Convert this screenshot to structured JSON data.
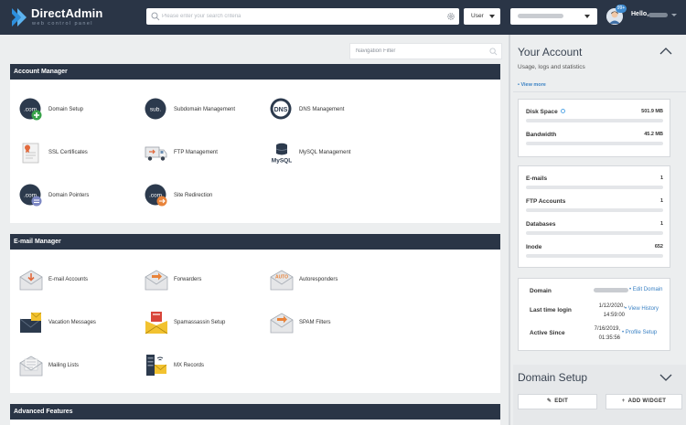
{
  "brand": {
    "name": "DirectAdmin",
    "tagline": "web control panel"
  },
  "header": {
    "search_placeholder": "Please enter your search criteria",
    "level_select": "User",
    "notification_badge": "99+",
    "greeting": "Hello,"
  },
  "nav_filter": {
    "placeholder": "Navigation Filter"
  },
  "account_manager": {
    "title": "Account Manager",
    "items": [
      {
        "label": "Domain Setup",
        "icon": "domain-setup-icon"
      },
      {
        "label": "Subdomain Management",
        "icon": "subdomain-icon"
      },
      {
        "label": "DNS Management",
        "icon": "dns-icon"
      },
      {
        "label": "SSL Certificates",
        "icon": "ssl-certificate-icon"
      },
      {
        "label": "FTP Management",
        "icon": "ftp-truck-icon"
      },
      {
        "label": "MySQL Management",
        "icon": "mysql-icon"
      },
      {
        "label": "Domain Pointers",
        "icon": "domain-pointer-icon"
      },
      {
        "label": "Site Redirection",
        "icon": "site-redirection-icon"
      }
    ],
    "icon_texts": {
      "com": ".com",
      "sub": "sub.",
      "dns": "DNS",
      "mysql": "MySQL"
    }
  },
  "email_manager": {
    "title": "E-mail Manager",
    "items": [
      {
        "label": "E-mail Accounts",
        "icon": "email-accounts-icon"
      },
      {
        "label": "Forwarders",
        "icon": "forwarders-icon"
      },
      {
        "label": "Autoresponders",
        "icon": "autoresponders-icon"
      },
      {
        "label": "Vacation Messages",
        "icon": "vacation-messages-icon"
      },
      {
        "label": "Spamassassin Setup",
        "icon": "spamassassin-icon"
      },
      {
        "label": "SPAM Filters",
        "icon": "spam-filters-icon"
      },
      {
        "label": "Mailing Lists",
        "icon": "mailing-lists-icon"
      },
      {
        "label": "MX Records",
        "icon": "mx-records-icon"
      }
    ],
    "icon_texts": {
      "auto": "AUTO"
    }
  },
  "advanced": {
    "title": "Advanced Features"
  },
  "your_account": {
    "title": "Your Account",
    "subtitle": "Usage, logs and statistics",
    "view_more": "• View more",
    "usage": [
      {
        "name": "Disk Space",
        "value": "501.9 MB",
        "fraction": 0
      },
      {
        "name": "Bandwidth",
        "value": "45.2 MB",
        "fraction": 0
      }
    ],
    "counts": [
      {
        "name": "E-mails",
        "value": "1",
        "fraction": 0
      },
      {
        "name": "FTP Accounts",
        "value": "1",
        "fraction": 0
      },
      {
        "name": "Databases",
        "value": "1",
        "fraction": 0
      },
      {
        "name": "Inode",
        "value": "652",
        "fraction": 0
      }
    ],
    "info": {
      "domain_label": "Domain",
      "edit_domain": "• Edit Domain",
      "last_login_label": "Last time login",
      "last_login_date": "1/12/2020,",
      "last_login_time": "14:59:00",
      "view_history": "• View History",
      "active_since_label": "Active Since",
      "active_since_date": "7/16/2019,",
      "active_since_time": "01:35:56",
      "profile_setup": "• Profile Setup"
    }
  },
  "domain_setup_widget": {
    "title": "Domain Setup",
    "edit_button": "EDIT",
    "add_widget_button": "ADD WIDGET"
  },
  "colors": {
    "header_bg": "#2a3546",
    "accent": "#3b82c4",
    "brand_blue": "#2d8fdd"
  }
}
